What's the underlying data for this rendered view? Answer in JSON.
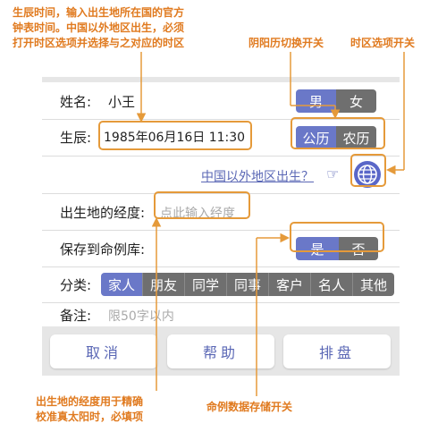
{
  "annotations": {
    "timezone_note": [
      "生辰时间，输入出生地所在国的官方",
      "钟表时间。中国以外地区出生，必须",
      "打开时区选项并选择与之对应的时区"
    ],
    "calendar_switch": "阴阳历切换开关",
    "timezone_switch": "时区选项开关",
    "longitude_note": [
      "出生地的经度用于精确",
      "校准真太阳时，必填项"
    ],
    "save_switch": "命例数据存储开关"
  },
  "form": {
    "name_label": "姓名:",
    "name_value": "小王",
    "gender": {
      "male": "男",
      "female": "女",
      "selected": "male"
    },
    "birth_label": "生辰:",
    "birth_value": "1985年06月16日 11:30",
    "calendar": {
      "solar": "公历",
      "lunar": "农历",
      "selected": "solar"
    },
    "overseas_link": "中国以外地区出生？",
    "pointer_icon": "pointing-hand-icon",
    "globe_icon": "globe-icon",
    "longitude_label": "出生地的经度:",
    "longitude_placeholder": "点此输入经度",
    "save_label": "保存到命例库:",
    "save_toggle": {
      "yes": "是",
      "no": "否",
      "selected": "yes"
    },
    "category_label": "分类:",
    "categories": [
      "家人",
      "朋友",
      "同学",
      "同事",
      "客户",
      "名人",
      "其他"
    ],
    "category_selected": "家人",
    "note_label": "备注:",
    "note_placeholder": "限50字以内"
  },
  "buttons": {
    "cancel": "取消",
    "help": "帮助",
    "arrange": "排盘"
  },
  "colors": {
    "accent": "#6a78c8",
    "annotation": "#e07a1f",
    "segment_off": "#6f6f6f",
    "panel_bg": "#e6e6e6"
  }
}
